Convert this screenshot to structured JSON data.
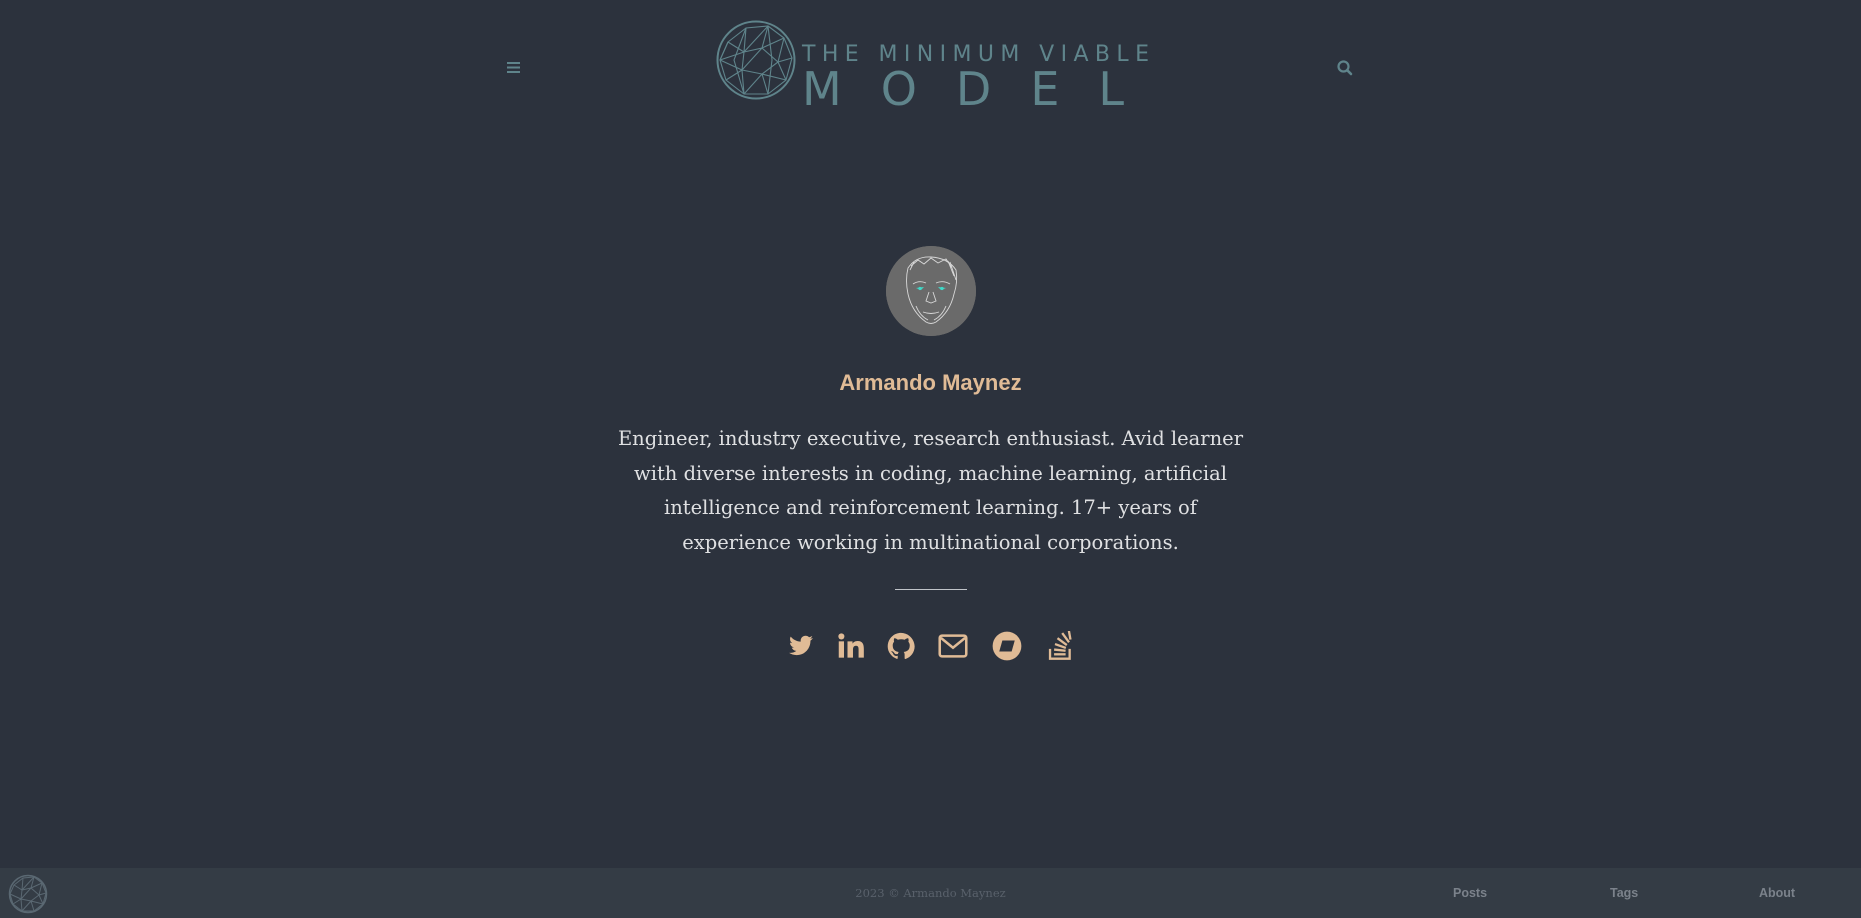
{
  "site": {
    "logo_top": "THE MINIMUM VIABLE",
    "logo_bottom": "MODEL"
  },
  "header": {
    "menu_icon": "hamburger-menu-icon",
    "search_icon": "search-icon"
  },
  "profile": {
    "name": "Armando Maynez",
    "bio": "Engineer, industry executive, research enthusiast. Avid learner with diverse interests in coding, machine learning, artificial intelligence and reinforcement learning. 17+ years of experience working in multinational corporations.",
    "socials": [
      "twitter-icon",
      "linkedin-icon",
      "github-icon",
      "email-icon",
      "sketchfab-icon",
      "stackoverflow-icon"
    ]
  },
  "footer": {
    "copyright": "2023 © Armando Maynez",
    "links": [
      "Posts",
      "Tags",
      "About"
    ]
  },
  "colors": {
    "background": "#2c323d",
    "footer_bg": "#343c45",
    "accent": "#e0bb96",
    "logo": "#5f848b",
    "text": "#dfe0e2"
  }
}
